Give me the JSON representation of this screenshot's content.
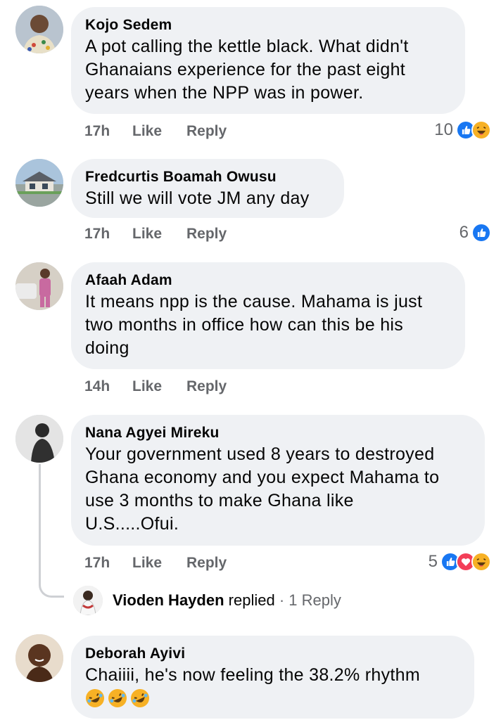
{
  "comments": [
    {
      "author": "Kojo Sedem",
      "lines": [
        "A pot calling the kettle black. What didn't",
        "Ghanaians experience for the past eight",
        "years when the NPP was in power."
      ],
      "time": "17h",
      "like": "Like",
      "reply": "Reply",
      "reaction_count": "10",
      "reactions": [
        "like-icon",
        "haha-icon"
      ]
    },
    {
      "author": "Fredcurtis Boamah Owusu",
      "lines": [
        "Still we will vote JM any day"
      ],
      "time": "17h",
      "like": "Like",
      "reply": "Reply",
      "reaction_count": "6",
      "reactions": [
        "like-icon"
      ]
    },
    {
      "author": "Afaah Adam",
      "lines": [
        "It means npp is the cause. Mahama is just",
        "two months in office how can this be his",
        "doing"
      ],
      "time": "14h",
      "like": "Like",
      "reply": "Reply"
    },
    {
      "author": "Nana Agyei Mireku",
      "lines": [
        "Your government used 8 years to destroyed",
        "Ghana economy and you expect Mahama to",
        "use 3 months to make Ghana like",
        "U.S.....Ofui."
      ],
      "time": "17h",
      "like": "Like",
      "reply": "Reply",
      "reaction_count": "5",
      "reactions": [
        "like-icon",
        "love-icon",
        "haha-icon"
      ],
      "replied": {
        "name": "Vioden Hayden",
        "verb": "replied",
        "count": "· 1 Reply"
      }
    },
    {
      "author": "Deborah Ayivi",
      "lines": [
        "Chaiiii, he's now feeling the 38.2% rhythm"
      ],
      "emojis": [
        "rofl-emoji",
        "rofl-emoji",
        "rofl-emoji"
      ]
    }
  ],
  "colors": {
    "bubble": "#eff1f4",
    "meta_text": "#65676b",
    "like_blue": "#1877f2",
    "love_red": "#f33e58",
    "haha_yellow": "#f7b125"
  }
}
